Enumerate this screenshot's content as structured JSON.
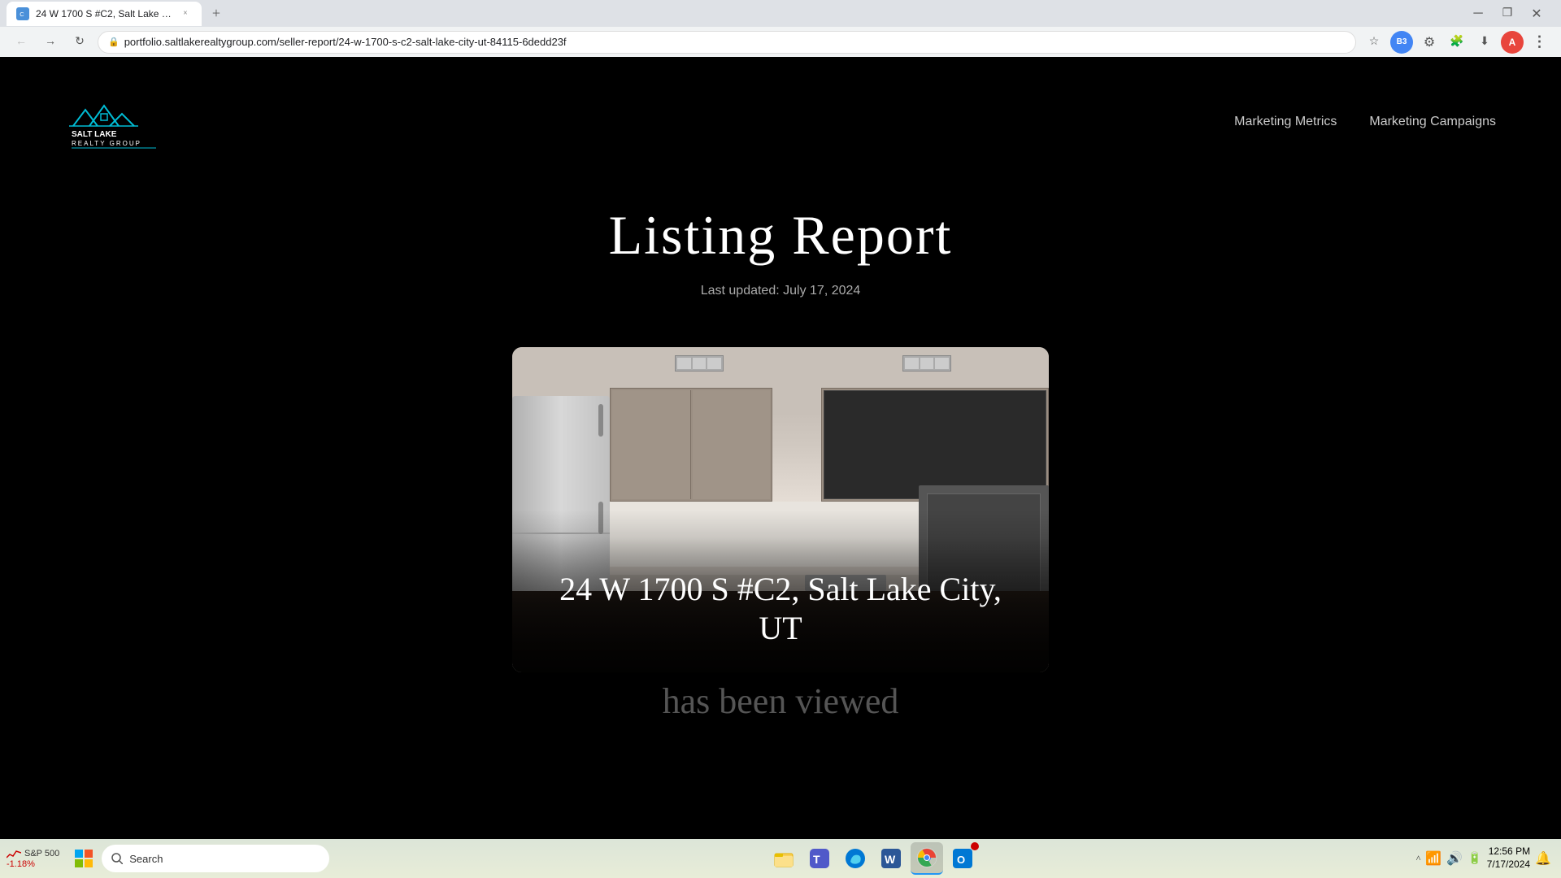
{
  "browser": {
    "tab": {
      "title": "24 W 1700 S #C2, Salt Lake Cit...",
      "close_label": "×"
    },
    "new_tab_label": "+",
    "address": "portfolio.saltlakerealtygroup.com/seller-report/24-w-1700-s-c2-salt-lake-city-ut-84115-6dedd23f",
    "nav": {
      "back_disabled": false,
      "forward_disabled": false
    }
  },
  "site": {
    "logo_text": "SALT LAKE\nREALTY GROUP",
    "nav": {
      "marketing_metrics": "Marketing Metrics",
      "marketing_campaigns": "Marketing Campaigns"
    },
    "hero": {
      "title": "Listing Report",
      "last_updated": "Last updated: July 17, 2024"
    },
    "property": {
      "address": "24 W 1700 S #C2, Salt Lake City, UT",
      "viewed_text": "has been viewed"
    }
  },
  "taskbar": {
    "search_placeholder": "Search",
    "clock": {
      "time": "12:56 PM",
      "date": "7/17/2024"
    },
    "stock": {
      "name": "S&P 500",
      "change": "-1.18%"
    }
  }
}
